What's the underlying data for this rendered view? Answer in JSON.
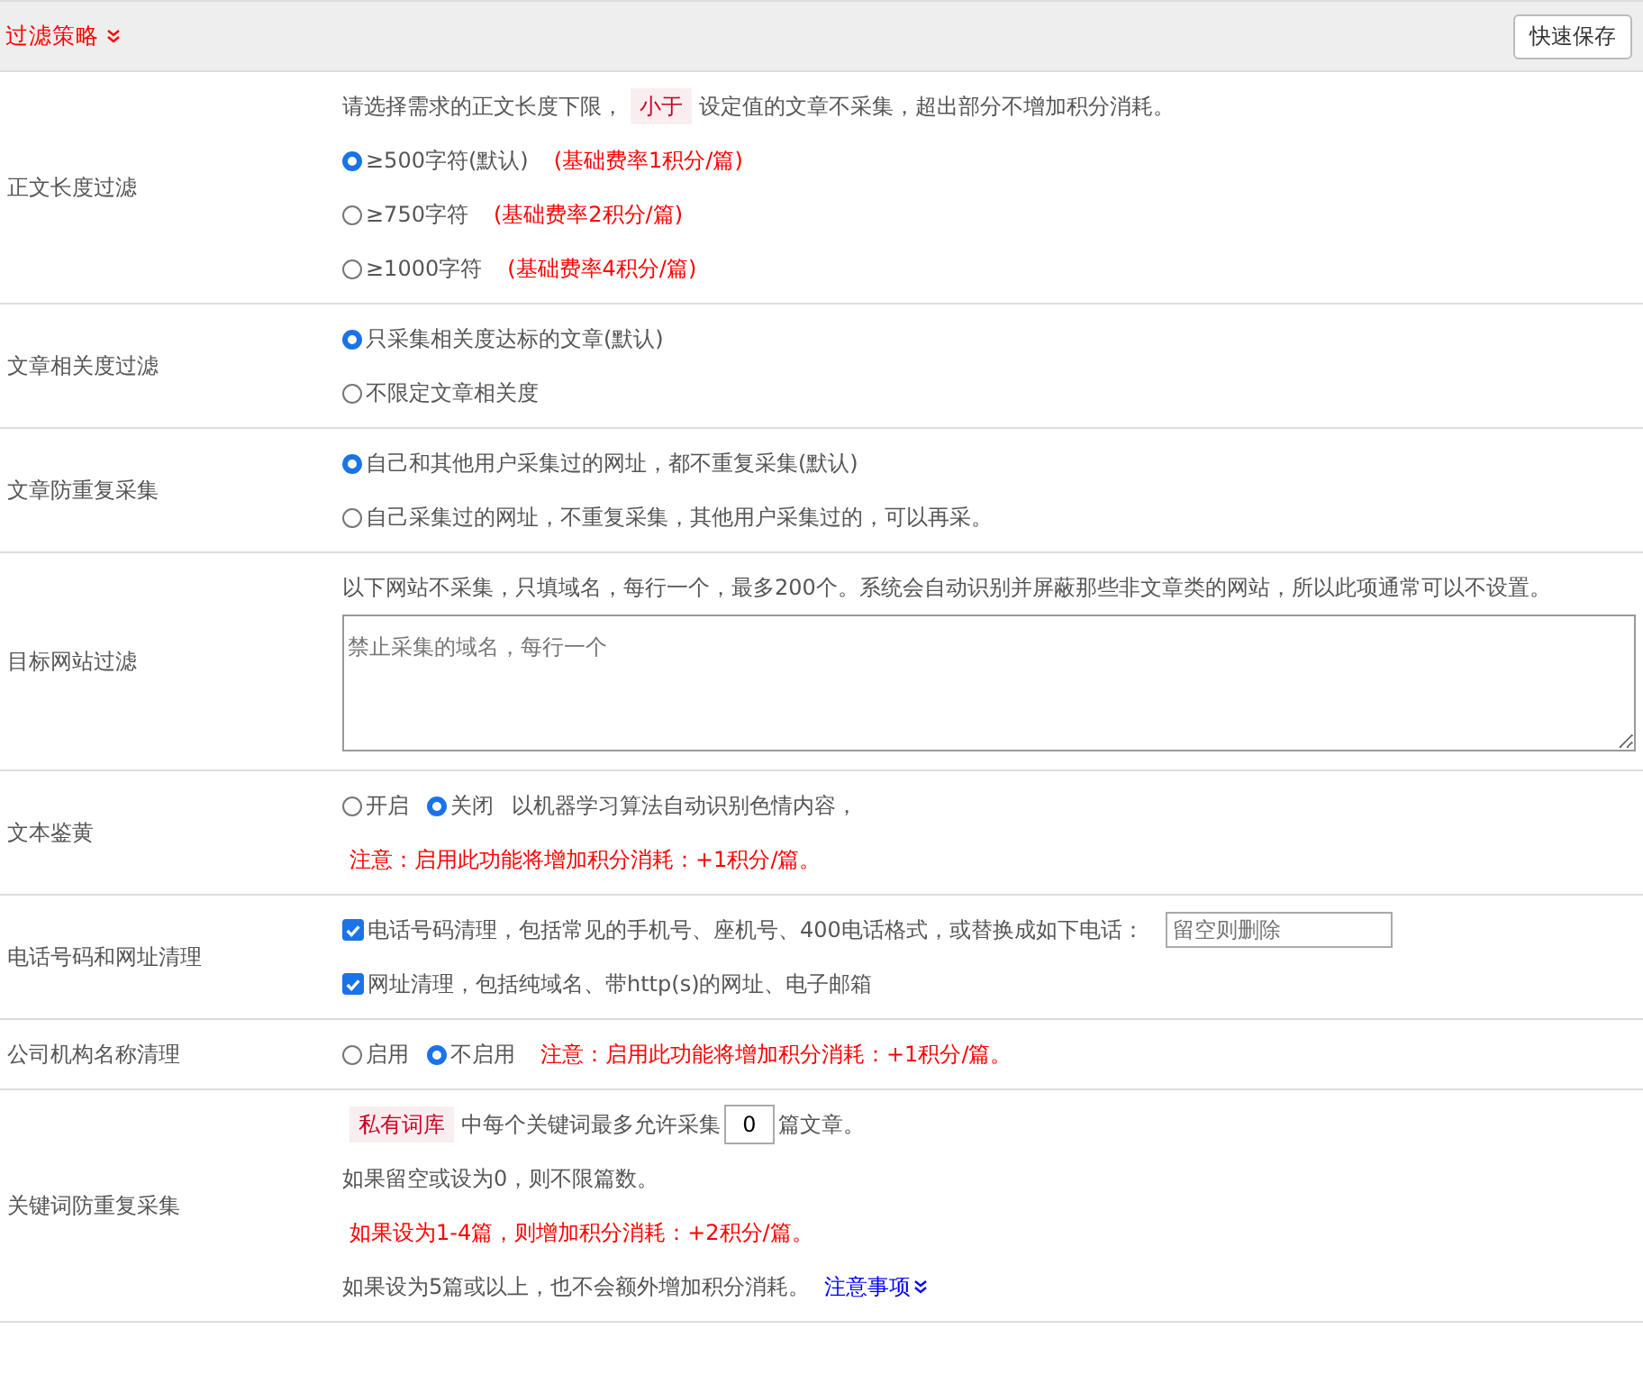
{
  "header": {
    "title": "过滤策略",
    "button": "快速保存"
  },
  "rows": [
    {
      "label": "正文长度过滤",
      "lines": [
        {
          "segments": [
            {
              "kind": "text",
              "text": "请选择需求的正文长度下限，"
            },
            {
              "kind": "tag",
              "text": "小于"
            },
            {
              "kind": "text",
              "text": "设定值的文章不采集，超出部分不增加积分消耗。"
            }
          ]
        },
        {
          "segments": [
            {
              "kind": "radio",
              "text": "≥500字符(默认)",
              "selected": true
            },
            {
              "kind": "warn",
              "text": "(基础费率1积分/篇)"
            }
          ]
        },
        {
          "segments": [
            {
              "kind": "radio",
              "text": "≥750字符",
              "selected": false
            },
            {
              "kind": "warn",
              "text": "(基础费率2积分/篇)"
            }
          ]
        },
        {
          "segments": [
            {
              "kind": "radio",
              "text": "≥1000字符",
              "selected": false
            },
            {
              "kind": "warn",
              "text": "(基础费率4积分/篇)"
            }
          ]
        }
      ]
    },
    {
      "label": "文章相关度过滤",
      "lines": [
        {
          "segments": [
            {
              "kind": "radio",
              "text": "只采集相关度达标的文章(默认)",
              "selected": true
            }
          ]
        },
        {
          "segments": [
            {
              "kind": "radio",
              "text": "不限定文章相关度",
              "selected": false
            }
          ]
        }
      ]
    },
    {
      "label": "文章防重复采集",
      "lines": [
        {
          "segments": [
            {
              "kind": "radio",
              "text": "自己和其他用户采集过的网址，都不重复采集(默认)",
              "selected": true
            }
          ]
        },
        {
          "segments": [
            {
              "kind": "radio",
              "text": "自己采集过的网址，不重复采集，其他用户采集过的，可以再采。",
              "selected": false
            }
          ]
        }
      ]
    },
    {
      "label": "目标网站过滤",
      "lines": [
        {
          "segments": [
            {
              "kind": "text",
              "text": "以下网站不采集，只填域名，每行一个，最多200个。系统会自动识别并屏蔽那些非文章类的网站，所以此项通常可以不设置。"
            }
          ]
        },
        {
          "segments": [
            {
              "kind": "textarea",
              "placeholder": "禁止采集的域名，每行一个"
            }
          ]
        }
      ]
    },
    {
      "label": "文本鉴黄",
      "lines": [
        {
          "segments": [
            {
              "kind": "radio",
              "text": "开启",
              "selected": false
            },
            {
              "kind": "radio",
              "text": "关闭",
              "selected": true
            },
            {
              "kind": "text",
              "text": "以机器学习算法自动识别色情内容，"
            }
          ]
        },
        {
          "segments": [
            {
              "kind": "warn",
              "text": "注意：启用此功能将增加积分消耗：+1积分/篇。"
            }
          ]
        }
      ]
    },
    {
      "label": "电话号码和网址清理",
      "lines": [
        {
          "segments": [
            {
              "kind": "checkbox",
              "text": "电话号码清理，包括常见的手机号、座机号、400电话格式，或替换成如下电话：",
              "checked": true
            },
            {
              "kind": "input",
              "placeholder": "留空则删除"
            }
          ]
        },
        {
          "segments": [
            {
              "kind": "checkbox",
              "text": "网址清理，包括纯域名、带http(s)的网址、电子邮箱",
              "checked": true
            }
          ]
        }
      ]
    },
    {
      "label": "公司机构名称清理",
      "lines": [
        {
          "segments": [
            {
              "kind": "radio",
              "text": "启用",
              "selected": false
            },
            {
              "kind": "radio",
              "text": "不启用",
              "selected": true
            },
            {
              "kind": "warn",
              "text": "注意：启用此功能将增加积分消耗：+1积分/篇。"
            }
          ]
        }
      ]
    },
    {
      "label": "关键词防重复采集",
      "lines": [
        {
          "segments": [
            {
              "kind": "tag",
              "text": "私有词库"
            },
            {
              "kind": "text",
              "text": "中每个关键词最多允许采集"
            },
            {
              "kind": "number",
              "value": "0"
            },
            {
              "kind": "text",
              "text": "篇文章。"
            }
          ]
        },
        {
          "segments": [
            {
              "kind": "text",
              "text": "如果留空或设为0，则不限篇数。"
            }
          ]
        },
        {
          "segments": [
            {
              "kind": "warn",
              "text": "如果设为1-4篇，则增加积分消耗：+2积分/篇。"
            }
          ]
        },
        {
          "segments": [
            {
              "kind": "text",
              "text": "如果设为5篇或以上，也不会额外增加积分消耗。"
            },
            {
              "kind": "link",
              "text": "注意事项"
            }
          ]
        }
      ]
    }
  ]
}
